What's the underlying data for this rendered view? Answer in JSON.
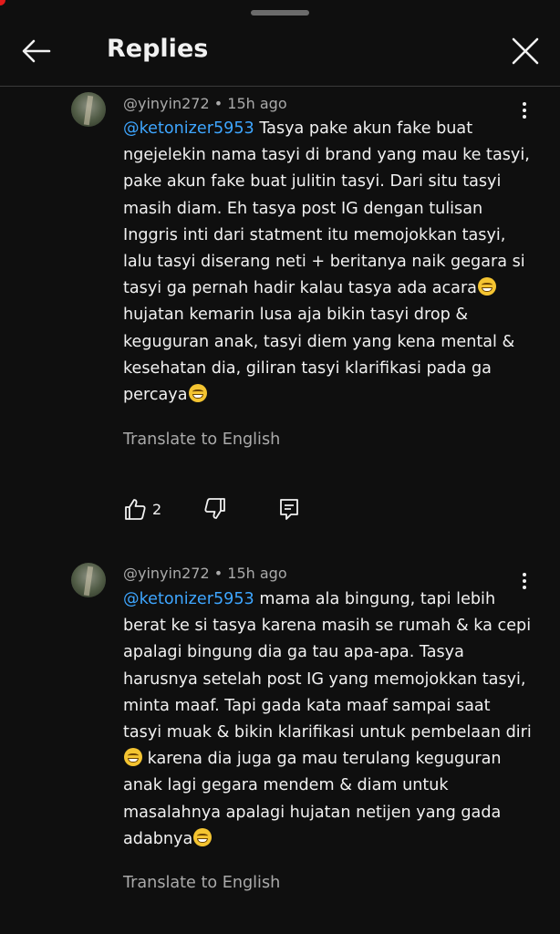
{
  "header": {
    "title": "Replies"
  },
  "icons": {
    "back": "back-arrow-icon",
    "close": "close-icon",
    "more": "more-vertical-icon",
    "like": "thumbs-up-icon",
    "dislike": "thumbs-down-icon",
    "reply": "reply-icon",
    "emoji": "grinning-squinting-face-emoji"
  },
  "comments": [
    {
      "author": "@yinyin272",
      "time": "15h ago",
      "mention": "@ketonizer5953",
      "text_parts": [
        " Tasya pake akun fake buat ngejelekin nama tasyi di brand yang mau ke tasyi, pake akun fake buat julitin tasyi. Dari situ tasyi masih diam. Eh tasya post IG dengan tulisan Inggris inti dari statment itu memojokkan tasyi, lalu tasyi diserang neti + beritanya naik gegara si tasyi ga pernah hadir kalau tasya ada acara",
        "\nhujatan kemarin lusa aja bikin tasyi drop & keguguran anak, tasyi diem yang kena mental & kesehatan dia, giliran tasyi klarifikasi pada ga percaya",
        ""
      ],
      "translate_label": "Translate to English",
      "like_count": "2"
    },
    {
      "author": "@yinyin272",
      "time": "15h ago",
      "mention": "@ketonizer5953",
      "text_parts": [
        " mama ala bingung, tapi lebih berat ke si tasya karena masih se rumah & ka cepi apalagi bingung dia ga tau apa-apa. Tasya harusnya setelah post IG yang memojokkan tasyi, minta maaf. Tapi gada kata maaf sampai saat tasyi muak & bikin klarifikasi untuk pembelaan diri",
        " karena dia juga ga mau terulang keguguran anak lagi gegara mendem & diam untuk masalahnya apalagi hujatan netijen yang gada adabnya",
        ""
      ],
      "translate_label": "Translate to English"
    }
  ]
}
